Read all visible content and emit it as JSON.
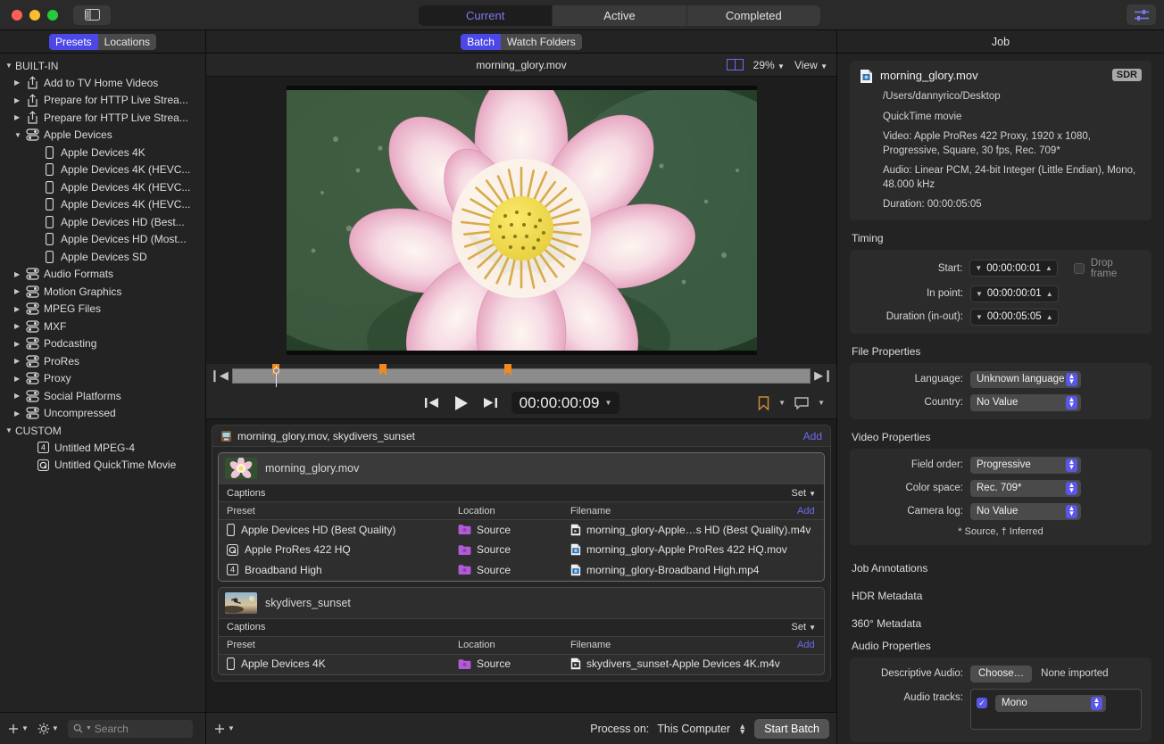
{
  "window": {
    "segmented_tabs": [
      {
        "label": "Current",
        "active": true
      },
      {
        "label": "Active",
        "active": false
      },
      {
        "label": "Completed",
        "active": false
      }
    ],
    "sidebar_toggle_icon": "sidebar-toggle-icon",
    "inspector_toggle_icon": "sliders-icon"
  },
  "sidebar": {
    "tabs": [
      {
        "label": "Presets",
        "selected": true
      },
      {
        "label": "Locations",
        "selected": false
      }
    ],
    "groups": [
      {
        "label": "BUILT-IN",
        "expanded": true,
        "items": [
          {
            "label": "Add to TV Home Videos",
            "icon": "share-icon",
            "disclosure": "collapsed",
            "level": 1
          },
          {
            "label": "Prepare for HTTP Live Strea...",
            "icon": "share-icon",
            "disclosure": "collapsed",
            "level": 1
          },
          {
            "label": "Prepare for HTTP Live Strea...",
            "icon": "share-icon",
            "disclosure": "collapsed",
            "level": 1
          },
          {
            "label": "Apple Devices",
            "icon": "preset-group-icon",
            "disclosure": "expanded",
            "level": 1
          },
          {
            "label": "Apple Devices 4K",
            "icon": "device-icon",
            "disclosure": "none",
            "level": 2
          },
          {
            "label": "Apple Devices 4K (HEVC...",
            "icon": "device-icon",
            "disclosure": "none",
            "level": 2
          },
          {
            "label": "Apple Devices 4K (HEVC...",
            "icon": "device-icon",
            "disclosure": "none",
            "level": 2
          },
          {
            "label": "Apple Devices 4K (HEVC...",
            "icon": "device-icon",
            "disclosure": "none",
            "level": 2
          },
          {
            "label": "Apple Devices HD (Best...",
            "icon": "device-icon",
            "disclosure": "none",
            "level": 2
          },
          {
            "label": "Apple Devices HD (Most...",
            "icon": "device-icon",
            "disclosure": "none",
            "level": 2
          },
          {
            "label": "Apple Devices SD",
            "icon": "device-icon",
            "disclosure": "none",
            "level": 2
          },
          {
            "label": "Audio Formats",
            "icon": "preset-group-icon",
            "disclosure": "collapsed",
            "level": 1
          },
          {
            "label": "Motion Graphics",
            "icon": "preset-group-icon",
            "disclosure": "collapsed",
            "level": 1
          },
          {
            "label": "MPEG Files",
            "icon": "preset-group-icon",
            "disclosure": "collapsed",
            "level": 1
          },
          {
            "label": "MXF",
            "icon": "preset-group-icon",
            "disclosure": "collapsed",
            "level": 1
          },
          {
            "label": "Podcasting",
            "icon": "preset-group-icon",
            "disclosure": "collapsed",
            "level": 1
          },
          {
            "label": "ProRes",
            "icon": "preset-group-icon",
            "disclosure": "collapsed",
            "level": 1
          },
          {
            "label": "Proxy",
            "icon": "preset-group-icon",
            "disclosure": "collapsed",
            "level": 1
          },
          {
            "label": "Social Platforms",
            "icon": "preset-group-icon",
            "disclosure": "collapsed",
            "level": 1
          },
          {
            "label": "Uncompressed",
            "icon": "preset-group-icon",
            "disclosure": "collapsed",
            "level": 1
          }
        ]
      },
      {
        "label": "CUSTOM",
        "expanded": true,
        "items": [
          {
            "label": "Untitled MPEG-4",
            "icon": "mpeg4-icon",
            "disclosure": "none",
            "level": 2
          },
          {
            "label": "Untitled QuickTime Movie",
            "icon": "quicktime-icon",
            "disclosure": "none",
            "level": 2
          }
        ]
      }
    ],
    "footer": {
      "add_icon": "plus-icon",
      "action_icon": "gear-icon",
      "search_placeholder": "Search",
      "search_value": "",
      "search_icon": "search-icon"
    }
  },
  "center": {
    "tabs": [
      {
        "label": "Batch",
        "selected": true
      },
      {
        "label": "Watch Folders",
        "selected": false
      }
    ],
    "preview": {
      "title": "morning_glory.mov",
      "split_icon": "split-view-icon",
      "zoom": "29%",
      "view_menu": "View"
    },
    "transport": {
      "prev_icon": "skip-to-start-icon",
      "play_icon": "play-icon",
      "next_icon": "skip-to-end-icon",
      "timecode": "00:00:00:09",
      "marker_icon": "marker-icon",
      "caption_icon": "caption-icon"
    },
    "batch": {
      "header_title": "morning_glory.mov, skydivers_sunset",
      "header_icon": "batch-icon",
      "header_add": "Add",
      "jobs": [
        {
          "name": "morning_glory.mov",
          "selected": true,
          "thumbnail": "lotus-thumbnail",
          "captions_label": "Captions",
          "captions_action": "Set",
          "columns": {
            "preset": "Preset",
            "location": "Location",
            "filename": "Filename",
            "add": "Add"
          },
          "outputs": [
            {
              "preset": "Apple Devices HD (Best Quality)",
              "preset_icon": "device-icon",
              "location": "Source",
              "location_icon": "folder-icon",
              "filename": "morning_glory-Apple…s HD (Best Quality).m4v",
              "file_icon": "m4v-file-icon"
            },
            {
              "preset": "Apple ProRes 422 HQ",
              "preset_icon": "quicktime-icon",
              "location": "Source",
              "location_icon": "folder-icon",
              "filename": "morning_glory-Apple ProRes 422 HQ.mov",
              "file_icon": "mov-file-icon"
            },
            {
              "preset": "Broadband High",
              "preset_icon": "mpeg4-icon",
              "location": "Source",
              "location_icon": "folder-icon",
              "filename": "morning_glory-Broadband High.mp4",
              "file_icon": "mp4-file-icon"
            }
          ]
        },
        {
          "name": "skydivers_sunset",
          "selected": false,
          "thumbnail": "skydivers-thumbnail",
          "captions_label": "Captions",
          "captions_action": "Set",
          "columns": {
            "preset": "Preset",
            "location": "Location",
            "filename": "Filename",
            "add": "Add"
          },
          "outputs": [
            {
              "preset": "Apple Devices 4K",
              "preset_icon": "device-icon",
              "location": "Source",
              "location_icon": "folder-icon",
              "filename": "skydivers_sunset-Apple Devices 4K.m4v",
              "file_icon": "m4v-file-icon"
            }
          ]
        }
      ]
    },
    "footer": {
      "add_icon": "plus-icon",
      "process_label": "Process on:",
      "process_value": "This Computer",
      "start_button": "Start Batch"
    }
  },
  "inspector": {
    "title": "Job",
    "file": {
      "icon": "mov-file-icon",
      "name": "morning_glory.mov",
      "badge": "SDR",
      "path": "/Users/dannyrico/Desktop",
      "kind": "QuickTime movie",
      "video": "Video: Apple ProRes 422 Proxy, 1920 x 1080, Progressive, Square, 30 fps, Rec. 709*",
      "audio": "Audio: Linear PCM, 24-bit Integer (Little Endian), Mono, 48.000 kHz",
      "duration": "Duration: 00:00:05:05"
    },
    "timing": {
      "title": "Timing",
      "start_label": "Start:",
      "start_value": "00:00:00:01",
      "inpoint_label": "In point:",
      "inpoint_value": "00:00:00:01",
      "duration_label": "Duration (in-out):",
      "duration_value": "00:00:05:05",
      "dropframe_label": "Drop frame",
      "dropframe_checked": false
    },
    "file_properties": {
      "title": "File Properties",
      "language_label": "Language:",
      "language_value": "Unknown language",
      "country_label": "Country:",
      "country_value": "No Value"
    },
    "video_properties": {
      "title": "Video Properties",
      "field_order_label": "Field order:",
      "field_order_value": "Progressive",
      "color_space_label": "Color space:",
      "color_space_value": "Rec. 709*",
      "camera_log_label": "Camera log:",
      "camera_log_value": "No Value",
      "footnote": "* Source, † Inferred"
    },
    "sections": [
      {
        "label": "Job Annotations"
      },
      {
        "label": "HDR Metadata"
      },
      {
        "label": "360° Metadata"
      }
    ],
    "audio_properties": {
      "title": "Audio Properties",
      "descriptive_label": "Descriptive Audio:",
      "choose_button": "Choose…",
      "descriptive_status": "None imported",
      "tracks_label": "Audio tracks:",
      "track_checked": true,
      "track_value": "Mono"
    }
  },
  "colors": {
    "accent": "#5a57e8",
    "link": "#6e6bf0",
    "marker": "#f08a1d",
    "folder": "#b35ad6"
  }
}
